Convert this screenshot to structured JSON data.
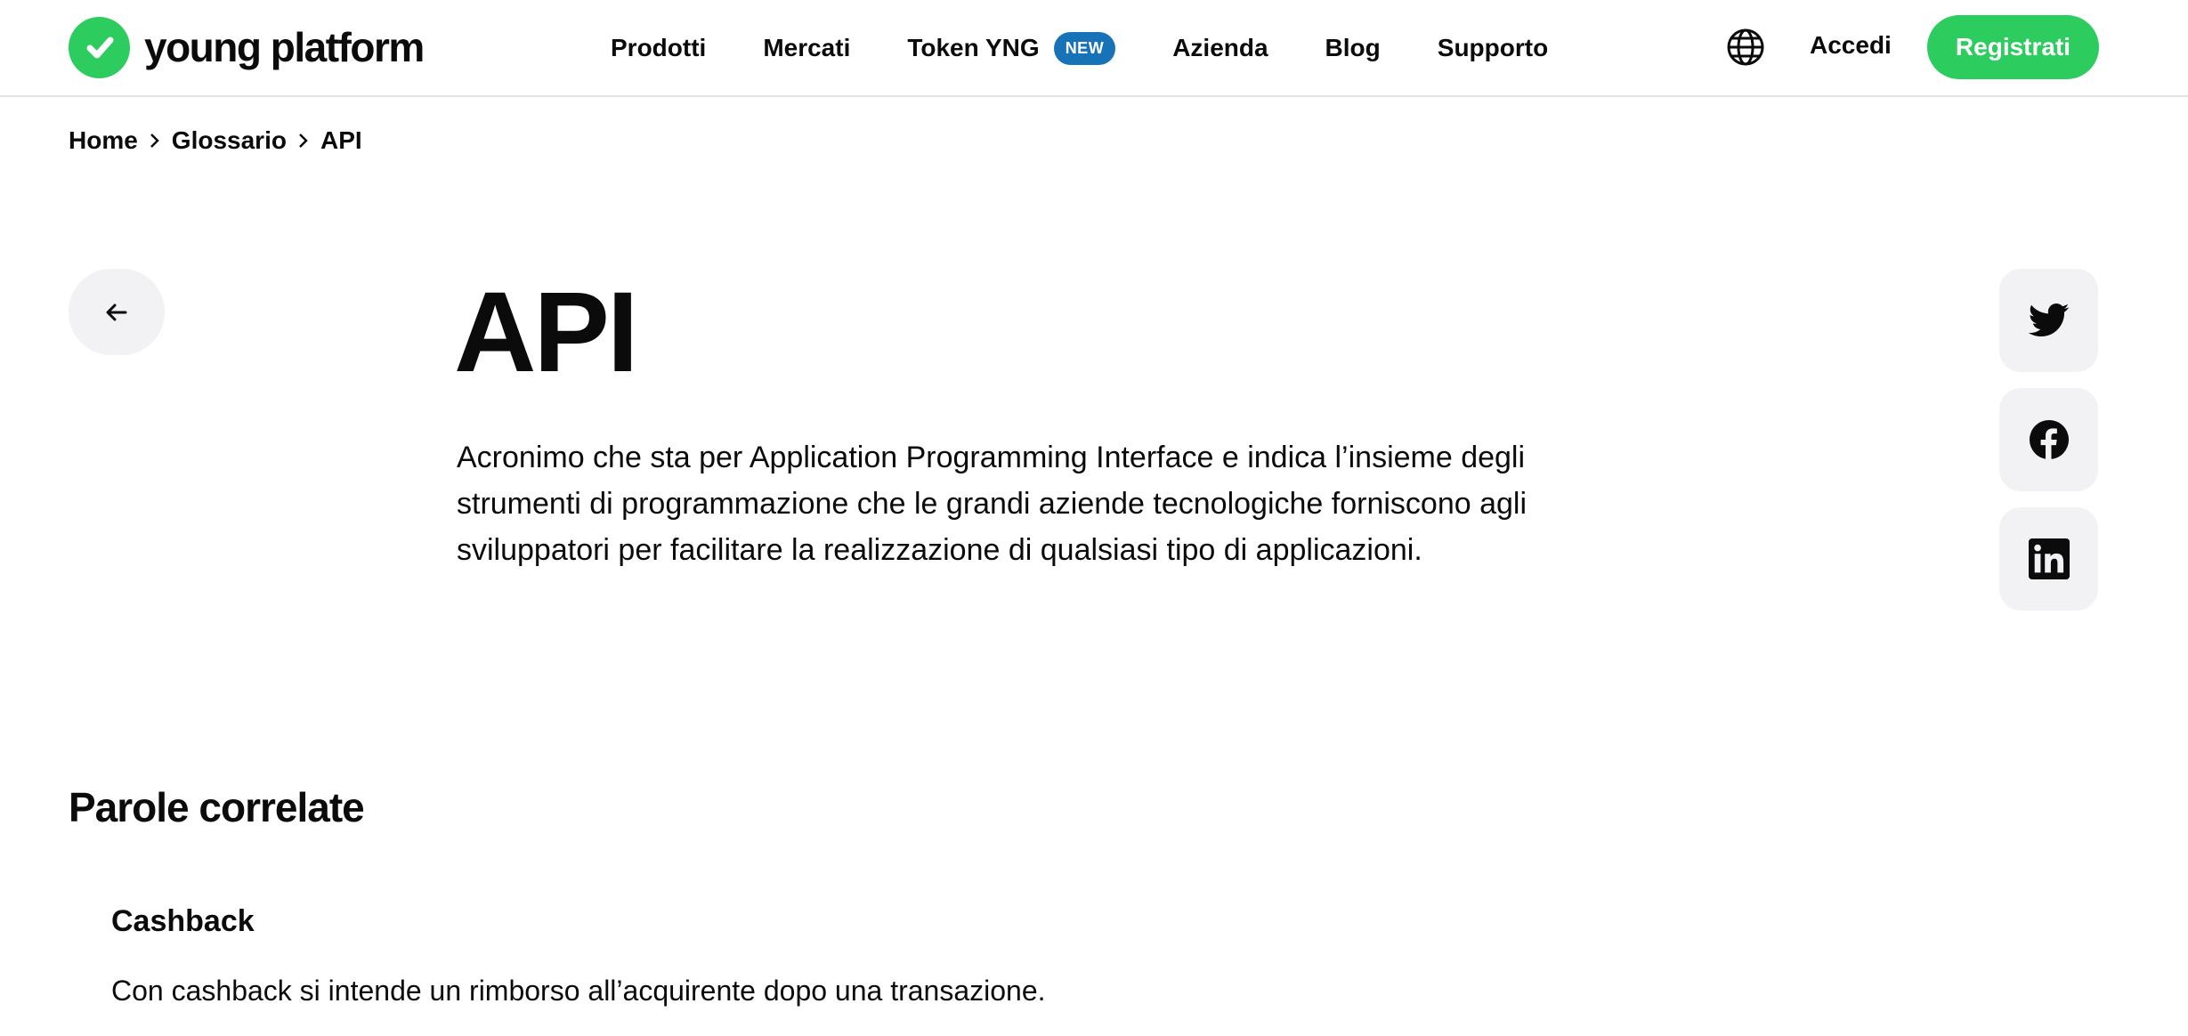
{
  "brand": {
    "name": "young platform",
    "accent": "#2ccc5e",
    "badge_color": "#1872b8"
  },
  "nav": {
    "items": [
      {
        "label": "Prodotti"
      },
      {
        "label": "Mercati"
      },
      {
        "label": "Token YNG",
        "badge": "NEW"
      },
      {
        "label": "Azienda"
      },
      {
        "label": "Blog"
      },
      {
        "label": "Supporto"
      }
    ]
  },
  "header": {
    "language_icon": "globe-icon",
    "login_label": "Accedi",
    "register_label": "Registrati"
  },
  "breadcrumb": [
    "Home",
    "Glossario",
    "API"
  ],
  "article": {
    "title": "API",
    "description": "Acronimo che sta per Application Programming Interface e indica l’insieme degli strumenti di programmazione che le grandi aziende tecnologiche forniscono agli sviluppatori per facilitare la realizzazione di qualsiasi tipo di applicazioni."
  },
  "share": {
    "icons": [
      "twitter-icon",
      "facebook-icon",
      "linkedin-icon"
    ]
  },
  "related": {
    "title": "Parole correlate",
    "items": [
      {
        "term": "Cashback",
        "definition": "Con cashback si intende un rimborso all’acquirente dopo una transazione."
      }
    ]
  }
}
